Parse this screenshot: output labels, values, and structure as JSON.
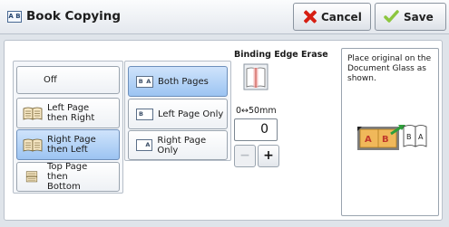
{
  "window": {
    "icon_text": "A B",
    "title": "Book Copying",
    "cancel_label": "Cancel",
    "save_label": "Save"
  },
  "book_layout_options": [
    {
      "label": "Off",
      "icon": "none",
      "selected": false
    },
    {
      "label": "Left Page then Right",
      "icon": "book-left-right-icon",
      "selected": false
    },
    {
      "label": "Right Page then Left",
      "icon": "book-right-left-icon",
      "selected": true
    },
    {
      "label": "Top Page then Bottom",
      "icon": "book-top-bottom-icon",
      "selected": false
    }
  ],
  "page_options": [
    {
      "label": "Both Pages",
      "icon_text_left": "B",
      "icon_text_right": "A",
      "selected": true
    },
    {
      "label": "Left Page Only",
      "icon_text_left": "B",
      "icon_text_right": "",
      "selected": false
    },
    {
      "label": "Right Page Only",
      "icon_text_left": "",
      "icon_text_right": "A",
      "selected": false
    }
  ],
  "binding_edge_erase": {
    "heading": "Binding Edge Erase",
    "range_label": "0↔50mm",
    "value": "0",
    "decrement_label": "−",
    "increment_label": "+",
    "decrement_enabled": false
  },
  "info": {
    "text": "Place original on the Document Glass as shown."
  },
  "colors": {
    "selected": "#9cc4f2",
    "cancel_icon": "#d61e12",
    "save_icon": "#8cc63f"
  }
}
